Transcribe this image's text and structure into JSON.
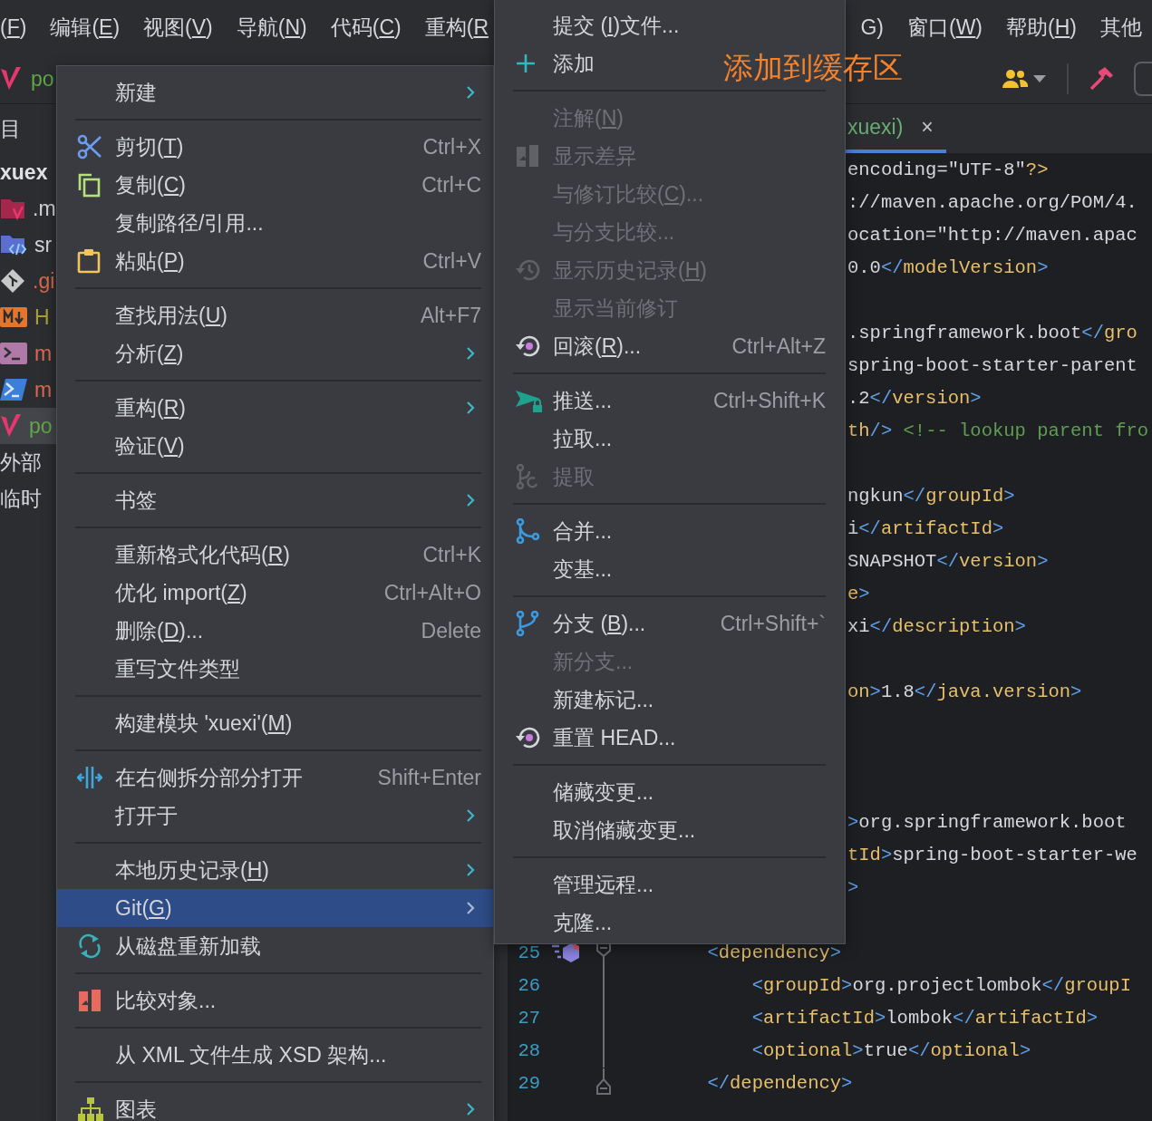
{
  "menubar": {
    "left": [
      {
        "label": "(F)",
        "mnemonic": true
      },
      {
        "label": "编辑(E)",
        "mnemonic": true
      },
      {
        "label": "视图(V)",
        "mnemonic": true
      },
      {
        "label": "导航(N)",
        "mnemonic": true
      },
      {
        "label": "代码(C)",
        "mnemonic": true
      },
      {
        "label": "重构(R",
        "mnemonic": true
      }
    ],
    "right": [
      {
        "label": "G)"
      },
      {
        "label": "窗口(W)",
        "mnemonic": true
      },
      {
        "label": "帮助(H)",
        "mnemonic": true
      },
      {
        "label": "其他"
      }
    ]
  },
  "toolbar": {
    "project": "po"
  },
  "project": {
    "header": "目",
    "items": [
      {
        "label": "xuex",
        "kind": "root",
        "color": "#dfe1e5",
        "selected": false
      },
      {
        "label": ".m",
        "kind": "file",
        "color": "#d3d5da",
        "selected": false
      },
      {
        "label": "sr",
        "kind": "file",
        "color": "#d3d5da",
        "selected": false
      },
      {
        "label": ".gi",
        "kind": "file",
        "color": "#d9694f",
        "selected": false
      },
      {
        "label": "H",
        "kind": "file",
        "color": "#a8a032",
        "selected": false
      },
      {
        "label": "m",
        "kind": "file",
        "color": "#d9694f",
        "selected": false
      },
      {
        "label": "m",
        "kind": "file",
        "color": "#d9694f",
        "selected": false
      },
      {
        "label": "po",
        "kind": "file",
        "color": "#5fa846",
        "selected": true
      },
      {
        "label": "外部",
        "kind": "group",
        "color": "#d3d5da",
        "selected": false
      },
      {
        "label": "临时",
        "kind": "group",
        "color": "#d3d5da",
        "selected": false
      }
    ]
  },
  "editor": {
    "tab": {
      "label": "xuexi)",
      "close": "×"
    },
    "rows": [
      {
        "kind": "cut",
        "text": "encoding=\"UTF-8\"?>"
      },
      {
        "kind": "cut",
        "text": "://maven.apache.org/POM/4."
      },
      {
        "kind": "cut",
        "text": "ocation=\"http://maven.apac"
      },
      {
        "kind": "cut",
        "text": "0.0</modelVersion>"
      },
      {
        "kind": "blank"
      },
      {
        "kind": "cut",
        "text": ".springframework.boot</gro"
      },
      {
        "kind": "cut",
        "text": "spring-boot-starter-parent"
      },
      {
        "kind": "cut",
        "text": ".2</version>"
      },
      {
        "kind": "cut",
        "text": "th/> <!-- lookup parent fro"
      },
      {
        "kind": "blank"
      },
      {
        "kind": "cut",
        "text": "ngkun</groupId>"
      },
      {
        "kind": "cut",
        "text": "i</artifactId>"
      },
      {
        "kind": "cut",
        "text": "SNAPSHOT</version>"
      },
      {
        "kind": "cut",
        "text": "e>"
      },
      {
        "kind": "cut",
        "text": "xi</description>"
      },
      {
        "kind": "blank"
      },
      {
        "kind": "cut",
        "text": "on>1.8</java.version>"
      },
      {
        "kind": "blank"
      },
      {
        "kind": "blank"
      },
      {
        "kind": "blank"
      },
      {
        "kind": "cut",
        "text": ">org.springframework.boot"
      },
      {
        "kind": "cut",
        "text": "tId>spring-boot-starter-we"
      },
      {
        "kind": "cut",
        "text": ">"
      },
      {
        "kind": "blank"
      },
      {
        "kind": "full",
        "number": "25",
        "text": "        <dependency>",
        "fold_start": true,
        "gutter_icon": true
      },
      {
        "kind": "full",
        "number": "26",
        "text": "            <groupId>org.projectlombok</groupI"
      },
      {
        "kind": "full",
        "number": "27",
        "text": "            <artifactId>lombok</artifactId>"
      },
      {
        "kind": "full",
        "number": "28",
        "text": "            <optional>true</optional>"
      },
      {
        "kind": "full",
        "number": "29",
        "text": "        </dependency>",
        "fold_end": true
      }
    ]
  },
  "context_menu": {
    "items": [
      {
        "kind": "item",
        "label": "新建",
        "submenu": true,
        "selected": false
      },
      {
        "kind": "separator"
      },
      {
        "kind": "item",
        "label": "剪切(T)",
        "shortcut": "Ctrl+X",
        "mnemonic": true,
        "selected": false
      },
      {
        "kind": "item",
        "label": "复制(C)",
        "shortcut": "Ctrl+C",
        "mnemonic": true,
        "selected": false
      },
      {
        "kind": "item",
        "label": "复制路径/引用...",
        "selected": false
      },
      {
        "kind": "item",
        "label": "粘贴(P)",
        "shortcut": "Ctrl+V",
        "mnemonic": true,
        "selected": false
      },
      {
        "kind": "separator"
      },
      {
        "kind": "item",
        "label": "查找用法(U)",
        "shortcut": "Alt+F7",
        "mnemonic": true,
        "selected": false
      },
      {
        "kind": "item",
        "label": "分析(Z)",
        "submenu": true,
        "mnemonic": true,
        "selected": false
      },
      {
        "kind": "separator"
      },
      {
        "kind": "item",
        "label": "重构(R)",
        "submenu": true,
        "mnemonic": true,
        "selected": false
      },
      {
        "kind": "item",
        "label": "验证(V)",
        "mnemonic": true,
        "selected": false
      },
      {
        "kind": "separator"
      },
      {
        "kind": "item",
        "label": "书签",
        "submenu": true,
        "selected": false
      },
      {
        "kind": "separator"
      },
      {
        "kind": "item",
        "label": "重新格式化代码(R)",
        "shortcut": "Ctrl+K",
        "mnemonic": true,
        "selected": false
      },
      {
        "kind": "item",
        "label": "优化 import(Z)",
        "shortcut": "Ctrl+Alt+O",
        "mnemonic": true,
        "selected": false
      },
      {
        "kind": "item",
        "label": "删除(D)...",
        "shortcut": "Delete",
        "mnemonic": true,
        "selected": false
      },
      {
        "kind": "item",
        "label": "重写文件类型",
        "selected": false
      },
      {
        "kind": "separator"
      },
      {
        "kind": "item",
        "label": "构建模块 'xuexi'(M)",
        "mnemonic": true,
        "selected": false
      },
      {
        "kind": "separator"
      },
      {
        "kind": "item",
        "label": "在右侧拆分部分打开",
        "shortcut": "Shift+Enter",
        "selected": false
      },
      {
        "kind": "item",
        "label": "打开于",
        "submenu": true,
        "selected": false
      },
      {
        "kind": "separator"
      },
      {
        "kind": "item",
        "label": "本地历史记录(H)",
        "submenu": true,
        "mnemonic": true,
        "selected": false
      },
      {
        "kind": "item",
        "label": "Git(G)",
        "submenu": true,
        "mnemonic": true,
        "selected": true
      },
      {
        "kind": "item",
        "label": "从磁盘重新加载",
        "selected": false
      },
      {
        "kind": "separator"
      },
      {
        "kind": "item",
        "label": "比较对象...",
        "selected": false
      },
      {
        "kind": "separator"
      },
      {
        "kind": "item",
        "label": "从 XML 文件生成 XSD 架构...",
        "selected": false
      },
      {
        "kind": "separator"
      },
      {
        "kind": "item",
        "label": "图表",
        "submenu": true,
        "selected": false
      }
    ]
  },
  "git_menu": {
    "items": [
      {
        "kind": "item",
        "label": "提交 (I)文件...",
        "mnemonic": true,
        "disabled": false
      },
      {
        "kind": "item",
        "label": "添加",
        "disabled": false
      },
      {
        "kind": "separator"
      },
      {
        "kind": "item",
        "label": "注解(N)",
        "mnemonic": true,
        "disabled": true
      },
      {
        "kind": "item",
        "label": "显示差异",
        "disabled": true
      },
      {
        "kind": "item",
        "label": "与修订比较(C)...",
        "mnemonic": true,
        "disabled": true
      },
      {
        "kind": "item",
        "label": "与分支比较...",
        "disabled": true
      },
      {
        "kind": "item",
        "label": "显示历史记录(H)",
        "mnemonic": true,
        "disabled": true
      },
      {
        "kind": "item",
        "label": "显示当前修订",
        "disabled": true
      },
      {
        "kind": "item",
        "label": "回滚(R)...",
        "shortcut": "Ctrl+Alt+Z",
        "mnemonic": true,
        "disabled": false
      },
      {
        "kind": "separator"
      },
      {
        "kind": "item",
        "label": "推送...",
        "shortcut": "Ctrl+Shift+K",
        "disabled": false
      },
      {
        "kind": "item",
        "label": "拉取...",
        "disabled": false
      },
      {
        "kind": "item",
        "label": "提取",
        "disabled": true
      },
      {
        "kind": "separator"
      },
      {
        "kind": "item",
        "label": "合并...",
        "disabled": false
      },
      {
        "kind": "item",
        "label": "变基...",
        "disabled": false
      },
      {
        "kind": "separator"
      },
      {
        "kind": "item",
        "label": "分支 (B)...",
        "shortcut": "Ctrl+Shift+`",
        "mnemonic": true,
        "disabled": false
      },
      {
        "kind": "item",
        "label": "新分支...",
        "disabled": true
      },
      {
        "kind": "item",
        "label": "新建标记...",
        "disabled": false
      },
      {
        "kind": "item",
        "label": "重置 HEAD...",
        "disabled": false
      },
      {
        "kind": "separator"
      },
      {
        "kind": "item",
        "label": "储藏变更...",
        "disabled": false
      },
      {
        "kind": "item",
        "label": "取消储藏变更...",
        "disabled": false
      },
      {
        "kind": "separator"
      },
      {
        "kind": "item",
        "label": "管理远程...",
        "disabled": false
      },
      {
        "kind": "item",
        "label": "克隆...",
        "disabled": false
      }
    ]
  },
  "annotation": {
    "text": "添加到缓存区"
  }
}
